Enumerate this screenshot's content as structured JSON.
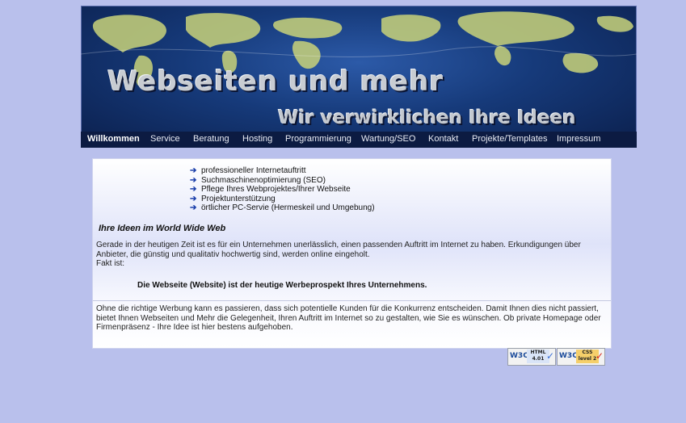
{
  "header": {
    "title": "Webseiten und mehr",
    "slogan": "Wir verwirklichen Ihre Ideen"
  },
  "nav": {
    "items": [
      {
        "label": "Willkommen",
        "active": true
      },
      {
        "label": "Service"
      },
      {
        "label": "Beratung"
      },
      {
        "label": "Hosting"
      },
      {
        "label": "Programmierung"
      },
      {
        "label": "Wartung/SEO"
      },
      {
        "label": "Kontakt"
      },
      {
        "label": "Projekte/Templates"
      },
      {
        "label": "Impressum"
      }
    ]
  },
  "content": {
    "features": [
      "professioneller Internetauftritt",
      "Suchmaschinenoptimierung (SEO)",
      "Pflege Ihres Webprojektes/Ihrer Webseite",
      "Projektunterstützung",
      "örtlicher PC-Servie (Hermeskeil und Umgebung)"
    ],
    "heading": "Ihre Ideen im World Wide Web",
    "intro_1": "Gerade in der heutigen Zeit ist es für ein Unternehmen unerlässlich, einen passenden Auftritt im Internet zu haben. Erkundigungen über Anbieter, die günstig und qualitativ hochwertig sind, werden online eingeholt.",
    "intro_2": "Fakt ist:",
    "highlight": "Die Webseite (Website) ist der heutige Werbeprospekt Ihres Unternehmens.",
    "closing": "Ohne die richtige Werbung kann es passieren, dass sich potentielle Kunden für die Konkurrenz entscheiden. Damit Ihnen dies nicht passiert, bietet Ihnen Webseiten und Mehr die Gelegenheit, Ihren Auftritt im Internet so zu gestalten, wie Sie es wünschen. Ob private Homepage oder Firmenpräsenz - Ihre Idee ist hier bestens aufgehoben."
  },
  "badges": {
    "html": {
      "logo": "W3C",
      "tag_line1": "HTML",
      "tag_line2": "4.01",
      "accent": "#3a6fd8"
    },
    "css": {
      "logo": "W3C",
      "tag_line1": "CSS",
      "tag_line2": "level 2",
      "accent": "#e8a21a"
    }
  },
  "colors": {
    "page_bg": "#b9c0ec",
    "nav_bg": "#0c1b42",
    "header_bg": "#163a7a",
    "continents": "#c9d37a",
    "bullet_arrow": "#1b3faa"
  },
  "icons": {
    "bullet": "arrow-right-icon",
    "badge_check": "check-icon"
  }
}
